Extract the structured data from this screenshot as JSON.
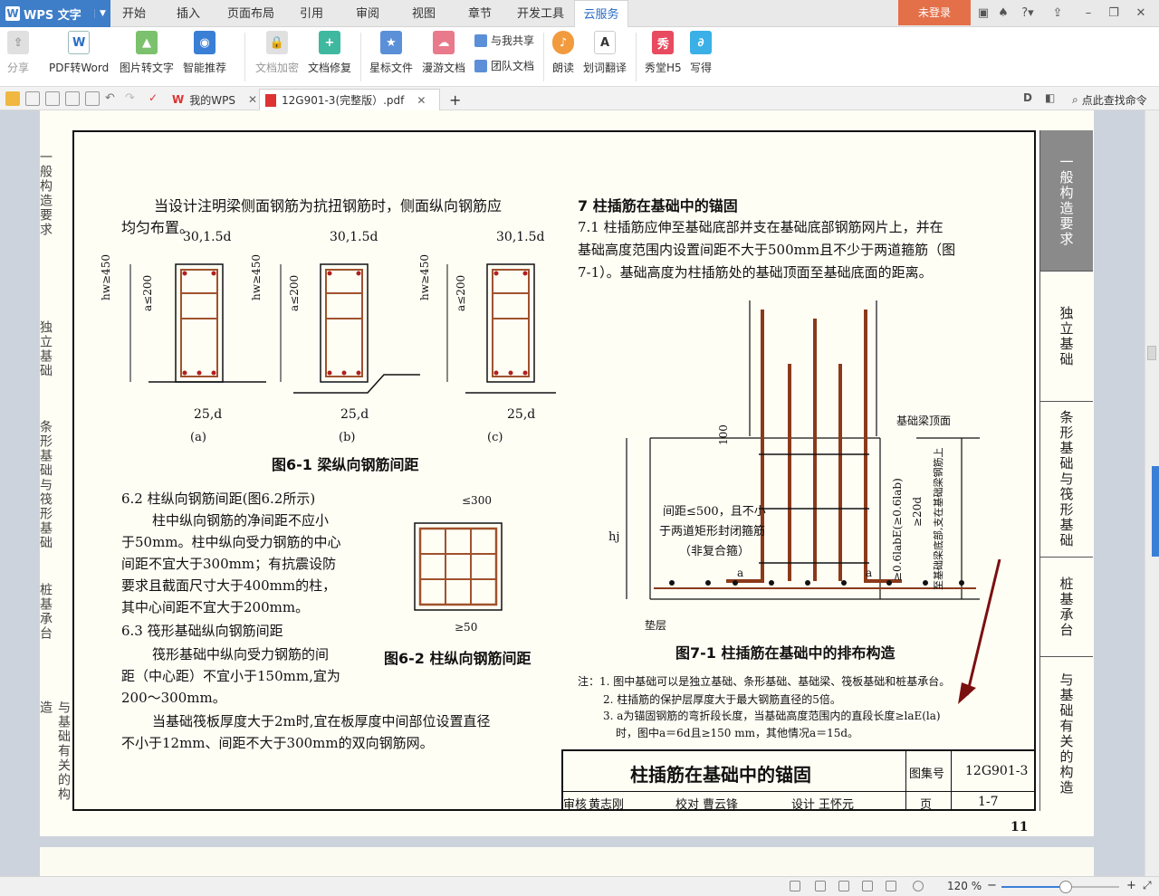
{
  "app": {
    "logo_text": "WPS 文字"
  },
  "menu": {
    "items": [
      {
        "label": "开始",
        "left": 0
      },
      {
        "label": "插入"
      },
      {
        "label": "页面布局"
      },
      {
        "label": "引用"
      },
      {
        "label": "审阅"
      },
      {
        "label": "视图"
      },
      {
        "label": "章节"
      },
      {
        "label": "开发工具"
      },
      {
        "label": "云服务"
      }
    ],
    "login": "未登录"
  },
  "ribbon": {
    "share": "分享",
    "pdf_word": "PDF转Word",
    "img_text": "图片转文字",
    "smart": "智能推荐",
    "encrypt": "文档加密",
    "repair": "文档修复",
    "star": "星标文件",
    "roam": "漫游文档",
    "share_with_me": "与我共享",
    "team_doc": "团队文档",
    "read": "朗读",
    "translate": "划词翻译",
    "xiutang": "秀堂H5",
    "xiede": "写得"
  },
  "tabs": {
    "my_wps": "我的WPS",
    "pdf_tab": "12G901-3(完整版）.pdf",
    "find_cmd": "点此查找命令"
  },
  "status": {
    "zoom": "120 %",
    "zoom_fraction": 0.5
  },
  "doc": {
    "side_labels": [
      "一般构造要求",
      "独立基础",
      "条形基础与筏形基础",
      "桩基承台",
      "与基础有关的构造"
    ],
    "left_labels": [
      "一般构造要求",
      "独立基础",
      "条形基础与筏形基础",
      "桩基承台",
      "与基础有关的构造"
    ],
    "p1": "当设计注明梁侧面钢筋为抗扭钢筋时，侧面纵向钢筋应",
    "p1b": "均匀布置。",
    "dim_top": "30,1.5d",
    "dim_bottom": "25,d",
    "sub_a": "(a)",
    "sub_b": "(b)",
    "sub_c": "(c)",
    "hw": "hw≥450",
    "a200": "a≤200",
    "fig61": "图6-1  梁纵向钢筋间距",
    "s62_title": "6.2  柱纵向钢筋间距(图6.2所示)",
    "s62_l1": "柱中纵向钢筋的净间距不应小",
    "s62_l2": "于50mm。柱中纵向受力钢筋的中心",
    "s62_l3": "间距不宜大于300mm；有抗震设防",
    "s62_l4": "要求且截面尺寸大于400mm的柱，",
    "s62_l5": "其中心间距不宜大于200mm。",
    "s63_title": "6.3  筏形基础纵向钢筋间距",
    "s63_l1": "筏形基础中纵向受力钢筋的间",
    "s63_l2": "距（中心距）不宜小于150mm,宜为",
    "s63_l3": "200～300mm。",
    "s63_l4": "当基础筏板厚度大于2m时,宜在板厚度中间部位设置直径",
    "s63_l5": "不小于12mm、间距不大于300mm的双向钢筋网。",
    "d300": "≤300",
    "d50": "≥50",
    "fig62": "图6-2  柱纵向钢筋间距",
    "s7_title": "7    柱插筋在基础中的锚固",
    "s71_l1": "7.1  柱插筋应伸至基础底部并支在基础底部钢筋网片上，并在",
    "s71_l2": "基础高度范围内设置间距不大于500mm且不少于两道箍筋（图",
    "s71_l3": "7-1）。基础高度为柱插筋处的基础顶面至基础底面的距离。",
    "beam_top": "基础梁顶面",
    "d100": "100",
    "hj": "hj",
    "stirrup1": "间距≤500，且不小",
    "stirrup2": "于两道矩形封闭箍筋",
    "stirrup3": "（非复合箍）",
    "anchor1": "≥0.6labE(≥0.6lab)",
    "anchor2": "≥20d",
    "anchor3": "至基础梁底部,支在基础梁钢筋上",
    "a_lbl": "a",
    "pad": "垫层",
    "fig71": "图7-1   柱插筋在基础中的排布构造",
    "note1": "注：1. 图中基础可以是独立基础、条形基础、基础梁、筏板基础和桩基承台。",
    "note2": "2. 柱插筋的保护层厚度大于最大钢筋直径的5倍。",
    "note3": "3. a为锚固钢筋的弯折段长度，当基础高度范围内的直段长度≥laE(la)",
    "note4": "时，图中a＝6d且≥150 mm，其他情况a＝15d。",
    "tb_title": "柱插筋在基础中的锚固",
    "tb_set_label": "图集号",
    "tb_set": "12G901-3",
    "tb_review": "审核",
    "tb_reviewer": "黄志刚",
    "tb_check": "校对",
    "tb_checker": "曹云锋",
    "tb_design": "设计",
    "tb_designer": "王怀元",
    "tb_page_label": "页",
    "tb_page": "1-7",
    "page_no": "11"
  }
}
